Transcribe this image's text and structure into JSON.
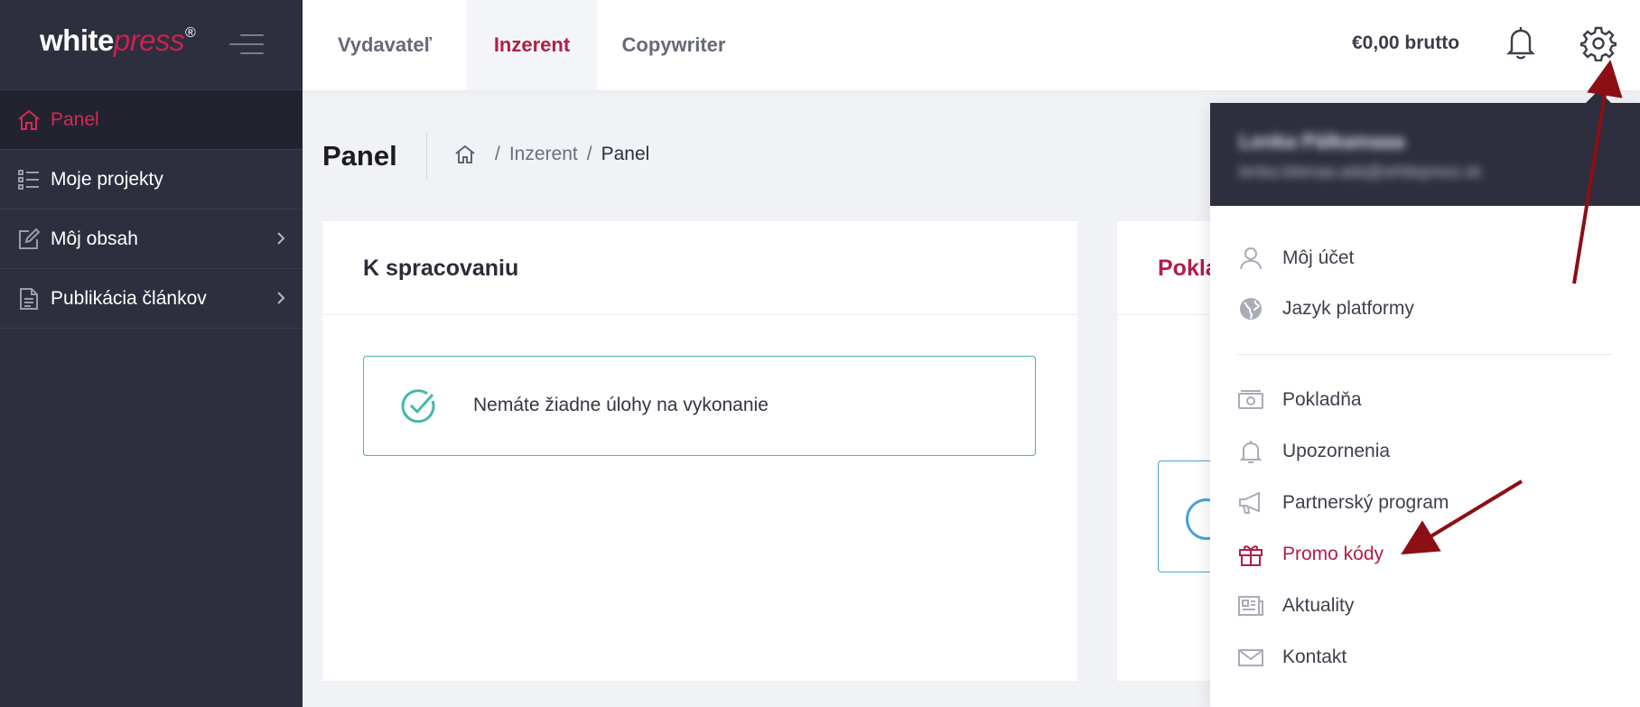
{
  "logo": {
    "white": "white",
    "press": "press",
    "reg": "®"
  },
  "sidebar": {
    "items": [
      {
        "label": "Panel",
        "icon": "home-icon",
        "active": true
      },
      {
        "label": "Moje projekty",
        "icon": "list-icon"
      },
      {
        "label": "Môj obsah",
        "icon": "edit-icon"
      },
      {
        "label": "Publikácia článkov",
        "icon": "document-icon"
      }
    ]
  },
  "topbar": {
    "tabs": [
      {
        "label": "Vydavateľ"
      },
      {
        "label": "Inzerent",
        "active": true
      },
      {
        "label": "Copywriter"
      }
    ],
    "balance": "€0,00 brutto"
  },
  "page": {
    "title": "Panel",
    "breadcrumb": [
      "Inzerent",
      "Panel"
    ]
  },
  "cards": {
    "tasks": {
      "title": "K spracovaniu",
      "notice": "Nemáte žiadne úlohy na vykonanie"
    },
    "cashbox": {
      "title": "Pokla"
    }
  },
  "dropdown": {
    "user_name": "Lenka Pálkamaaa",
    "user_email": "lenka.lelenaa.ada@whitepress.sk",
    "items": [
      {
        "label": "Môj účet",
        "icon": "user-icon"
      },
      {
        "label": "Jazyk platformy",
        "icon": "globe-icon"
      },
      {
        "label": "Pokladňa",
        "icon": "cash-icon"
      },
      {
        "label": "Upozornenia",
        "icon": "bell-icon"
      },
      {
        "label": "Partnerský program",
        "icon": "megaphone-icon"
      },
      {
        "label": "Promo kódy",
        "icon": "gift-icon",
        "highlight": true
      },
      {
        "label": "Aktuality",
        "icon": "newspaper-icon"
      },
      {
        "label": "Kontakt",
        "icon": "envelope-icon"
      }
    ]
  },
  "colors": {
    "sidebar_bg": "#2d2f3e",
    "accent": "#b01e47",
    "success": "#45b8a8",
    "annotation_arrow": "#8b0f14"
  }
}
